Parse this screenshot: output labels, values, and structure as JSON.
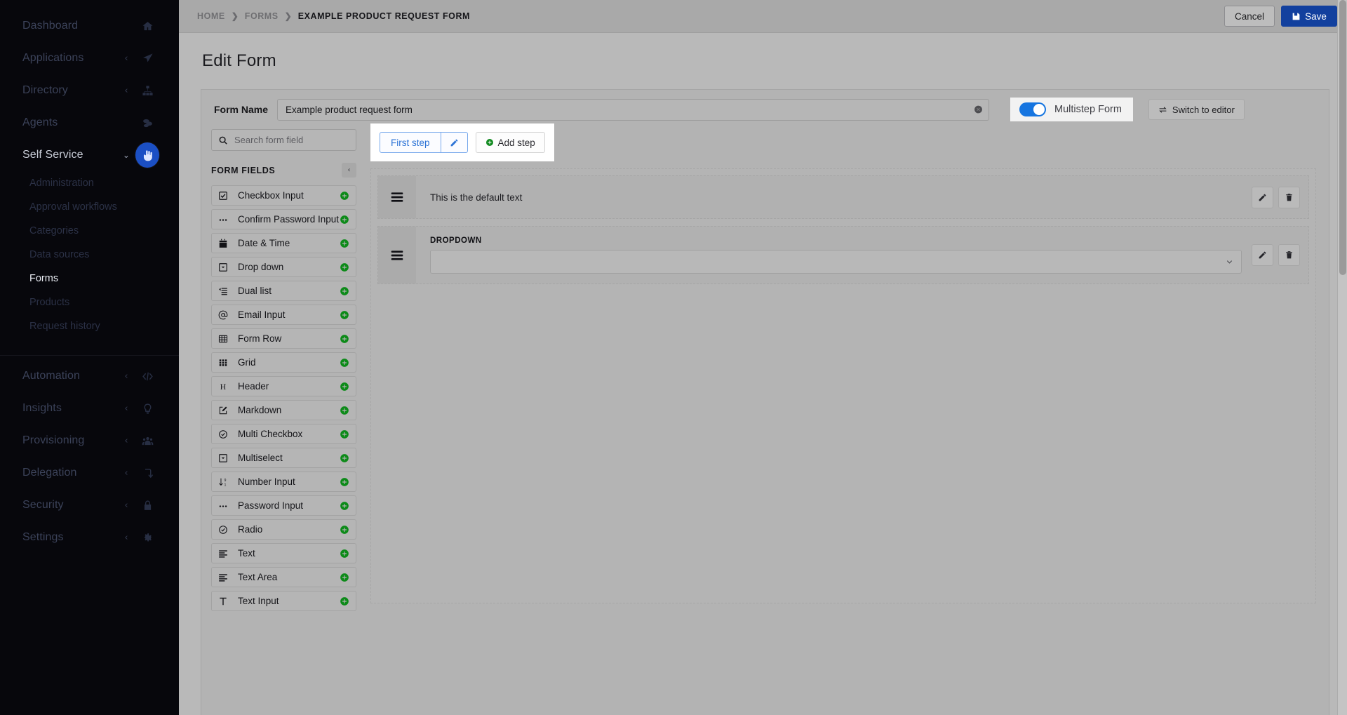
{
  "sidebar": {
    "items": [
      {
        "label": "Dashboard",
        "icon": "home-icon",
        "caret": "",
        "active": false
      },
      {
        "label": "Applications",
        "icon": "rocket-icon",
        "caret": "‹",
        "active": false
      },
      {
        "label": "Directory",
        "icon": "sitemap-icon",
        "caret": "‹",
        "active": false
      },
      {
        "label": "Agents",
        "icon": "agents-icon",
        "caret": "",
        "active": false
      },
      {
        "label": "Self Service",
        "icon": "hand-icon",
        "caret": "⌄",
        "active": true
      }
    ],
    "sub_items": [
      {
        "label": "Administration",
        "active": false
      },
      {
        "label": "Approval workflows",
        "active": false
      },
      {
        "label": "Categories",
        "active": false
      },
      {
        "label": "Data sources",
        "active": false
      },
      {
        "label": "Forms",
        "active": true
      },
      {
        "label": "Products",
        "active": false
      },
      {
        "label": "Request history",
        "active": false
      }
    ],
    "items_lower": [
      {
        "label": "Automation",
        "icon": "code-icon",
        "caret": "‹"
      },
      {
        "label": "Insights",
        "icon": "lightbulb-icon",
        "caret": "‹"
      },
      {
        "label": "Provisioning",
        "icon": "users-icon",
        "caret": "‹"
      },
      {
        "label": "Delegation",
        "icon": "delegation-icon",
        "caret": "‹"
      },
      {
        "label": "Security",
        "icon": "lock-icon",
        "caret": "‹"
      },
      {
        "label": "Settings",
        "icon": "gear-icon",
        "caret": "‹"
      }
    ]
  },
  "breadcrumb": {
    "home": "HOME",
    "forms": "FORMS",
    "current": "EXAMPLE PRODUCT REQUEST FORM",
    "separator": "❯"
  },
  "topbar": {
    "cancel_label": "Cancel",
    "save_label": "Save"
  },
  "page": {
    "title": "Edit Form"
  },
  "form_header": {
    "name_label": "Form Name",
    "name_value": "Example product request form",
    "name_placeholder": "Form name",
    "multistep_label": "Multistep Form",
    "multistep_on": true,
    "switch_label": "Switch to editor"
  },
  "palette": {
    "search_placeholder": "Search form field",
    "search_value": "",
    "title": "FORM FIELDS",
    "collapse_glyph": "‹",
    "fields": [
      {
        "label": "Checkbox Input",
        "icon": "checkbox-icon"
      },
      {
        "label": "Confirm Password Input",
        "icon": "dots-icon"
      },
      {
        "label": "Date & Time",
        "icon": "calendar-icon"
      },
      {
        "label": "Drop down",
        "icon": "dropdown-icon"
      },
      {
        "label": "Dual list",
        "icon": "duallist-icon"
      },
      {
        "label": "Email Input",
        "icon": "at-icon"
      },
      {
        "label": "Form Row",
        "icon": "table-icon"
      },
      {
        "label": "Grid",
        "icon": "grid-icon"
      },
      {
        "label": "Header",
        "icon": "heading-icon"
      },
      {
        "label": "Markdown",
        "icon": "markdown-icon"
      },
      {
        "label": "Multi Checkbox",
        "icon": "circle-check-icon"
      },
      {
        "label": "Multiselect",
        "icon": "dropdown-icon"
      },
      {
        "label": "Number Input",
        "icon": "number-icon"
      },
      {
        "label": "Password Input",
        "icon": "dots-icon"
      },
      {
        "label": "Radio",
        "icon": "circle-check-icon"
      },
      {
        "label": "Text",
        "icon": "text-icon"
      },
      {
        "label": "Text Area",
        "icon": "text-icon"
      },
      {
        "label": "Text Input",
        "icon": "textinput-icon"
      }
    ]
  },
  "steps": {
    "first_step_label": "First step",
    "add_step_label": "Add step"
  },
  "components": [
    {
      "type": "text",
      "text": "This is the default text",
      "label": ""
    },
    {
      "type": "dropdown",
      "text": "",
      "label": "DROPDOWN"
    }
  ]
}
